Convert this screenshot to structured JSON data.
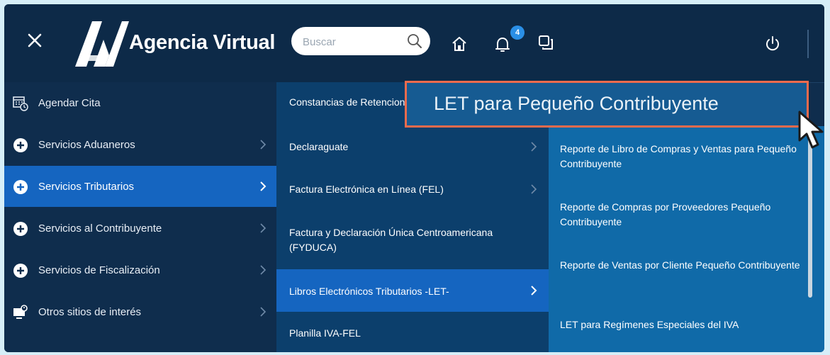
{
  "header": {
    "brand": "Agencia Virtual",
    "search_placeholder": "Buscar",
    "notification_count": "4"
  },
  "left_menu": {
    "items": [
      {
        "label": "Agendar Cita",
        "icon": "calendar-clock-icon",
        "has_submenu": false
      },
      {
        "label": "Servicios Aduaneros",
        "icon": "plus-circle-icon",
        "has_submenu": true
      },
      {
        "label": "Servicios Tributarios",
        "icon": "plus-circle-icon",
        "has_submenu": true,
        "active": true
      },
      {
        "label": "Servicios al Contribuyente",
        "icon": "plus-circle-icon",
        "has_submenu": true
      },
      {
        "label": "Servicios de Fiscalización",
        "icon": "plus-circle-icon",
        "has_submenu": true
      },
      {
        "label": "Otros sitios de interés",
        "icon": "monitor-user-icon",
        "has_submenu": true
      }
    ]
  },
  "middle_menu": {
    "items": [
      {
        "label": "Constancias de Retencion",
        "has_submenu": false
      },
      {
        "label": "Declaraguate",
        "has_submenu": true
      },
      {
        "label": "Factura Electrónica en Línea (FEL)",
        "has_submenu": true
      },
      {
        "label": "Factura y Declaración Única Centroamericana (FYDUCA)",
        "has_submenu": false
      },
      {
        "label": "Libros Electrónicos Tributarios -LET-",
        "has_submenu": true,
        "active": true
      },
      {
        "label": "Planilla IVA-FEL",
        "has_submenu": false
      }
    ]
  },
  "right_menu": {
    "highlighted": "LET para Pequeño Contribuyente",
    "items": [
      {
        "label": "Reporte de Libro de Compras y Ventas para Pequeño Contribuyente"
      },
      {
        "label": "Reporte de Compras por Proveedores Pequeño Contribuyente"
      },
      {
        "label": "Reporte de Ventas por Cliente Pequeño Contribuyente"
      },
      {
        "label": "LET para Regímenes Especiales del IVA"
      }
    ]
  },
  "colors": {
    "header_bg": "#0d2a48",
    "active_item": "#1565c0",
    "submenu_bg": "#106aa8",
    "highlight_border": "#ef6b4d"
  }
}
